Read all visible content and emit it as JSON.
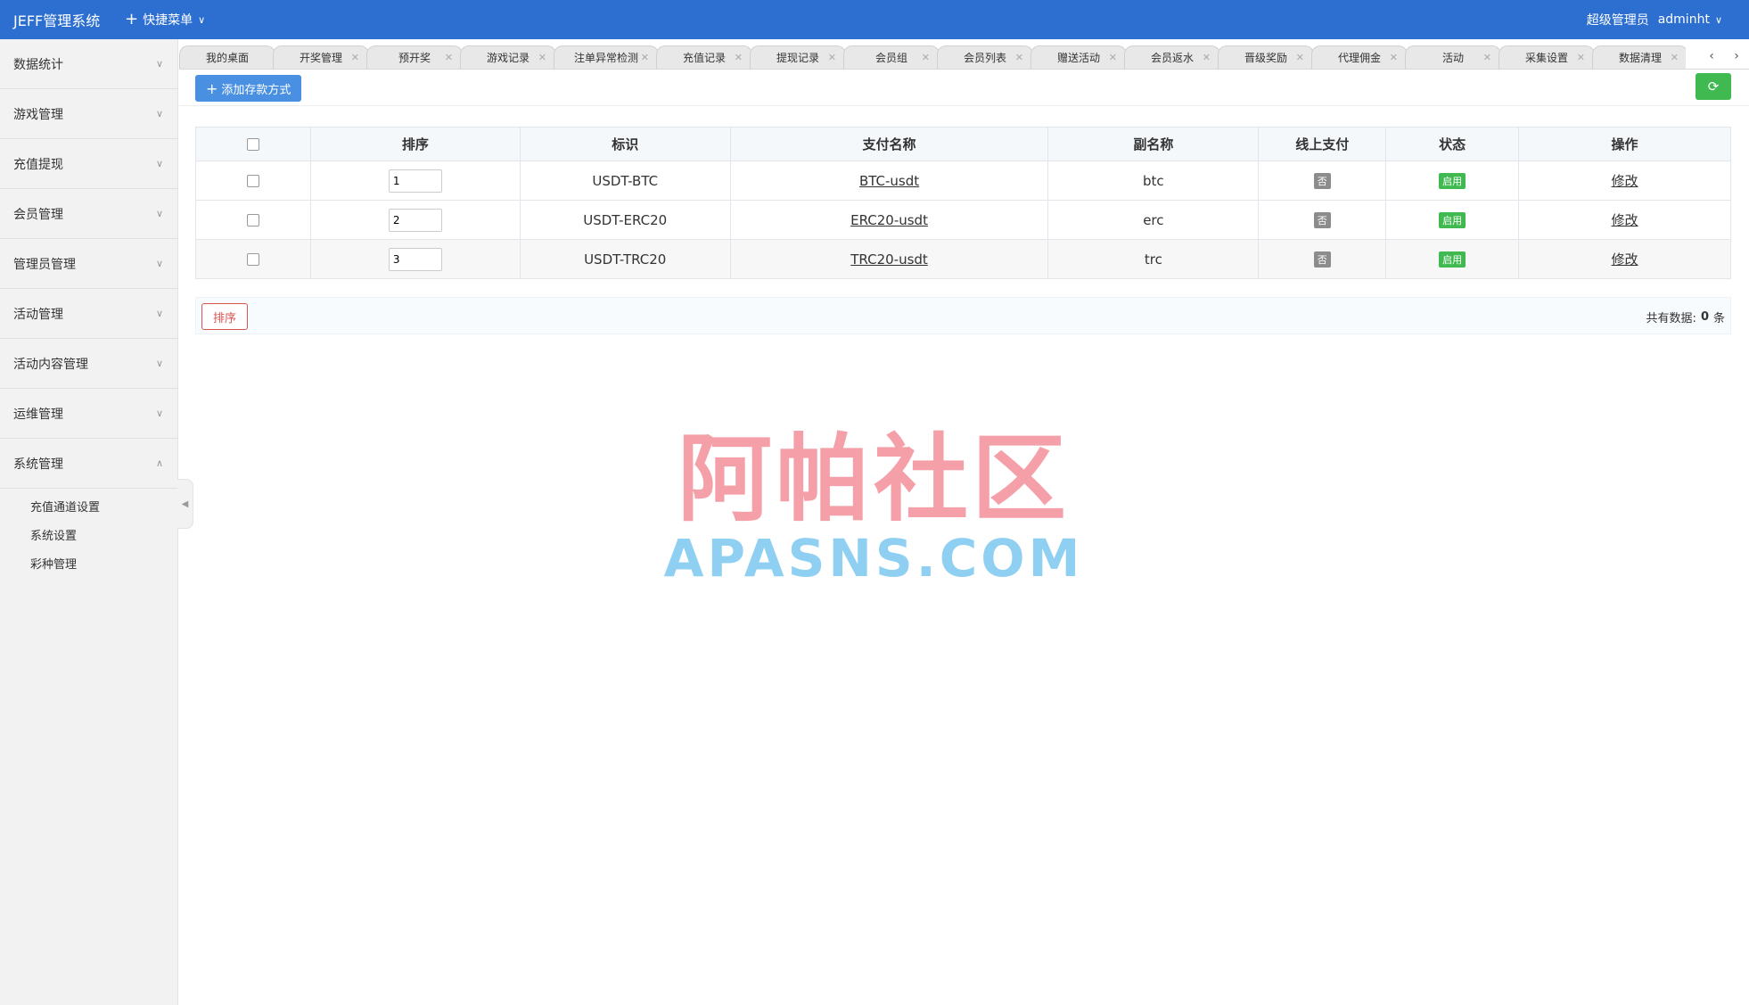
{
  "header": {
    "brand": "JEFF管理系统",
    "quick_menu": "快捷菜单",
    "role": "超级管理员",
    "username": "adminht"
  },
  "sidebar": {
    "items": [
      {
        "label": "数据统计"
      },
      {
        "label": "游戏管理"
      },
      {
        "label": "充值提现"
      },
      {
        "label": "会员管理"
      },
      {
        "label": "管理员管理"
      },
      {
        "label": "活动管理"
      },
      {
        "label": "活动内容管理"
      },
      {
        "label": "运维管理"
      },
      {
        "label": "系统管理"
      }
    ],
    "sub_items": [
      {
        "label": "充值通道设置"
      },
      {
        "label": "系统设置"
      },
      {
        "label": "彩种管理"
      }
    ]
  },
  "tabs": [
    {
      "label": "我的桌面"
    },
    {
      "label": "开奖管理"
    },
    {
      "label": "预开奖"
    },
    {
      "label": "游戏记录"
    },
    {
      "label": "注单异常检测"
    },
    {
      "label": "充值记录"
    },
    {
      "label": "提现记录"
    },
    {
      "label": "会员组"
    },
    {
      "label": "会员列表"
    },
    {
      "label": "赠送活动"
    },
    {
      "label": "会员返水"
    },
    {
      "label": "晋级奖励"
    },
    {
      "label": "代理佣金"
    },
    {
      "label": "活动"
    },
    {
      "label": "采集设置"
    },
    {
      "label": "数据清理"
    }
  ],
  "toolbar": {
    "add_label": "添加存款方式"
  },
  "table": {
    "headers": [
      "排序",
      "标识",
      "支付名称",
      "副名称",
      "线上支付",
      "状态",
      "操作"
    ],
    "rows": [
      {
        "sort": "1",
        "id": "USDT-BTC",
        "name": "BTC-usdt",
        "alias": "btc",
        "online": "否",
        "status": "启用",
        "action": "修改"
      },
      {
        "sort": "2",
        "id": "USDT-ERC20",
        "name": "ERC20-usdt",
        "alias": "erc",
        "online": "否",
        "status": "启用",
        "action": "修改"
      },
      {
        "sort": "3",
        "id": "USDT-TRC20",
        "name": "TRC20-usdt",
        "alias": "trc",
        "online": "否",
        "status": "启用",
        "action": "修改"
      }
    ]
  },
  "footer": {
    "sort_label": "排序",
    "total_prefix": "共有数据:",
    "total_count": "0",
    "total_suffix": "条"
  },
  "watermark": {
    "cn": "阿帕社区",
    "en": "APASNS.COM"
  },
  "colors": {
    "header_bg": "#2d6fd1",
    "primary_button": "#4a90e2",
    "success": "#3fb950",
    "danger": "#d9534f"
  }
}
